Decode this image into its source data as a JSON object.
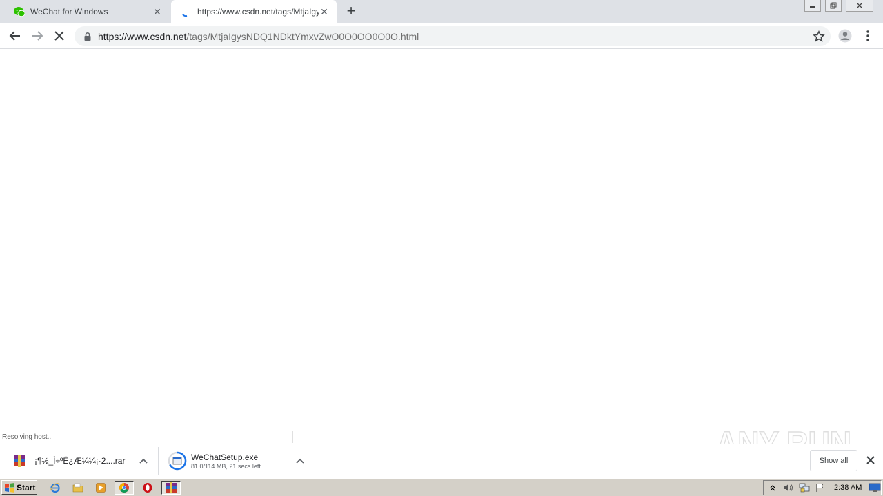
{
  "browser": {
    "tabs": [
      {
        "title": "WeChat for Windows",
        "active": false
      },
      {
        "title": "https://www.csdn.net/tags/MtjaIgysNDQ1NDktYmxvZwO0O0OO0O0O.html",
        "active": true
      }
    ],
    "address": {
      "domain": "https://www.csdn.net",
      "path": "/tags/MtjaIgysNDQ1NDktYmxvZwO0O0OO0O0O.html"
    },
    "status": "Resolving host..."
  },
  "downloads": {
    "items": [
      {
        "name": "¡¶½_Î÷ºË¿Æ¼¼¡·2....rar",
        "sub": ""
      },
      {
        "name": "WeChatSetup.exe",
        "sub": "81.0/114 MB, 21 secs left"
      }
    ],
    "show_all": "Show all"
  },
  "watermark": {
    "text": "ANY RUN"
  },
  "taskbar": {
    "start_label": "Start",
    "clock": "2:38 AM"
  },
  "colors": {
    "tab_strip": "#dee1e6",
    "omnibox": "#f1f3f4",
    "wechat_green": "#2dc100",
    "taskbar": "#d4d0c8"
  }
}
